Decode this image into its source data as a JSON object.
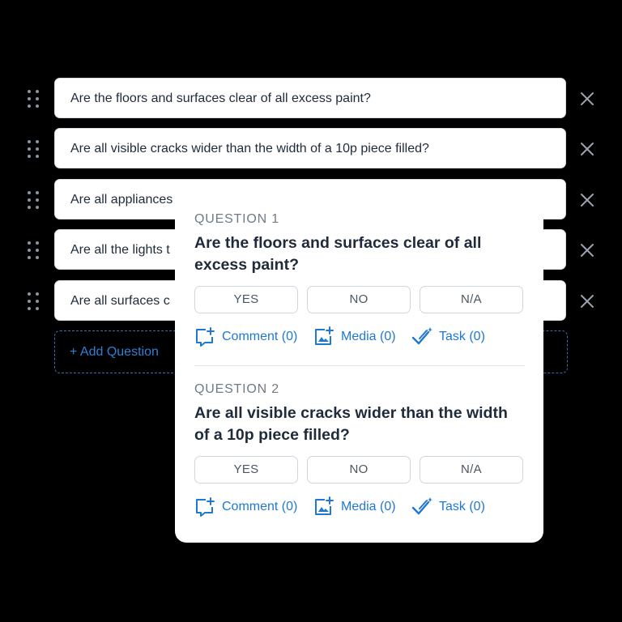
{
  "questions": [
    {
      "text": "Are the floors and surfaces clear of all excess paint?"
    },
    {
      "text": "Are all visible cracks wider than the width of a 10p piece filled?"
    },
    {
      "text": "Are all appliances"
    },
    {
      "text": "Are all the lights t"
    },
    {
      "text": "Are all surfaces c"
    }
  ],
  "add_question_label": "+ Add Question",
  "preview": {
    "items": [
      {
        "number_label": "QUESTION 1",
        "text": "Are the floors and surfaces clear of all excess paint?",
        "answers": [
          "YES",
          "NO",
          "N/A"
        ],
        "actions": {
          "comment": "Comment (0)",
          "media": "Media (0)",
          "task": "Task (0)"
        }
      },
      {
        "number_label": "QUESTION 2",
        "text": "Are all visible cracks wider than the width of a 10p piece filled?",
        "answers": [
          "YES",
          "NO",
          "N/A"
        ],
        "actions": {
          "comment": "Comment (0)",
          "media": "Media (0)",
          "task": "Task (0)"
        }
      }
    ]
  },
  "icons": {
    "drag": "drag-handle-icon",
    "remove": "close-icon",
    "comment": "comment-add-icon",
    "media": "image-add-icon",
    "task": "check-sparkle-icon"
  },
  "colors": {
    "background": "#000000",
    "accent": "#1f78d1",
    "dashed_border": "#3b6fb0",
    "text": "#1f2b3a",
    "muted": "#6f7b87"
  }
}
